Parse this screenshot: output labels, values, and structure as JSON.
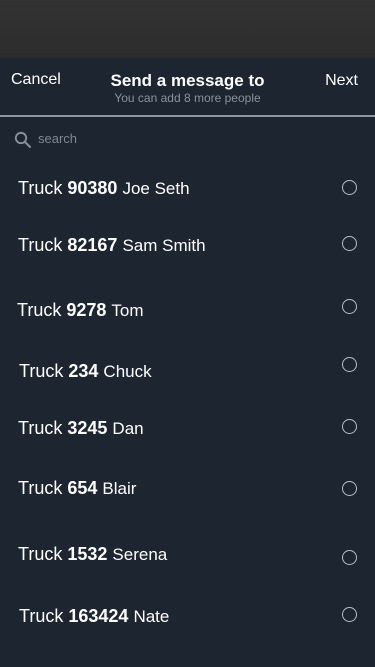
{
  "header": {
    "cancel_label": "Cancel",
    "title": "Send a message to",
    "subtitle": "You can add 8 more people",
    "next_label": "Next"
  },
  "search": {
    "placeholder": "search"
  },
  "contacts": [
    {
      "prefix": "Truck",
      "number": "90380",
      "name": "Joe Seth",
      "selected": false
    },
    {
      "prefix": "Truck",
      "number": "82167",
      "name": "Sam Smith",
      "selected": false
    },
    {
      "prefix": "Truck",
      "number": "9278",
      "name": "Tom",
      "selected": false
    },
    {
      "prefix": "Truck",
      "number": "234",
      "name": "Chuck",
      "selected": false
    },
    {
      "prefix": "Truck",
      "number": "3245",
      "name": "Dan",
      "selected": false
    },
    {
      "prefix": "Truck",
      "number": "654",
      "name": "Blair",
      "selected": false
    },
    {
      "prefix": "Truck",
      "number": "1532",
      "name": "Serena",
      "selected": false
    },
    {
      "prefix": "Truck",
      "number": "163424",
      "name": "Nate",
      "selected": false
    }
  ]
}
